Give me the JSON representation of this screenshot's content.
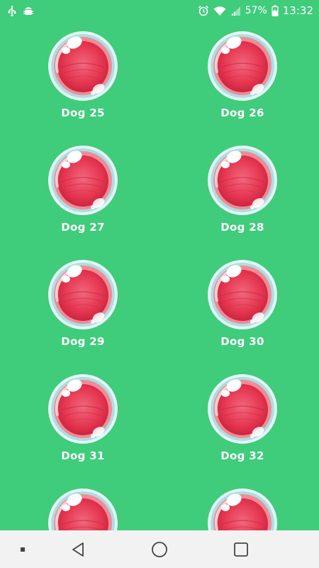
{
  "status_bar": {
    "left_icons": [
      "usb-icon",
      "android-debug-icon"
    ],
    "right_icons": [
      "alarm-icon",
      "wifi-icon",
      "signal-icon",
      "battery-charging-icon"
    ],
    "battery": "57%",
    "time": "13:32"
  },
  "grid": {
    "items": [
      {
        "label": "Dog 25"
      },
      {
        "label": "Dog 26"
      },
      {
        "label": "Dog 27"
      },
      {
        "label": "Dog 28"
      },
      {
        "label": "Dog 29"
      },
      {
        "label": "Dog 30"
      },
      {
        "label": "Dog 31"
      },
      {
        "label": "Dog 32"
      },
      {
        "label": ""
      },
      {
        "label": ""
      }
    ]
  },
  "nav_bar": {
    "buttons": [
      "menu-dot-icon",
      "back-icon",
      "home-icon",
      "recents-icon"
    ]
  },
  "colors": {
    "background": "#3fcc7b",
    "bubble_red": "#e83a55",
    "bubble_ring": "#8fd6d6",
    "nav_background": "#f2f2f2"
  }
}
